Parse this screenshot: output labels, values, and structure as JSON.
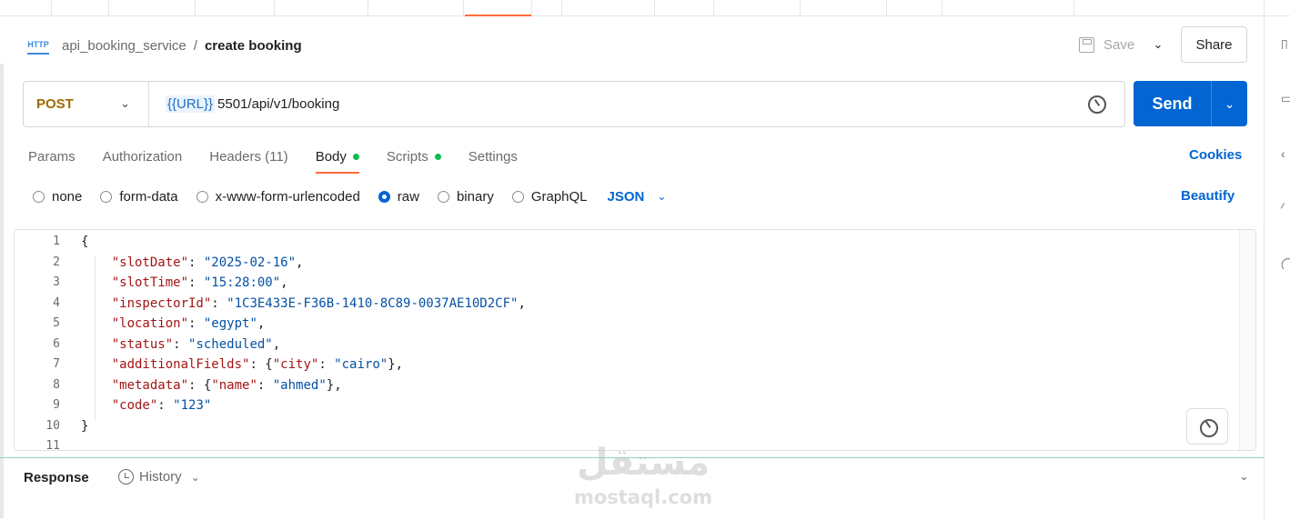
{
  "breadcrumb": {
    "collection": "api_booking_service",
    "separator": "/",
    "request": "create booking"
  },
  "toolbar": {
    "save_label": "Save",
    "share_label": "Share"
  },
  "request": {
    "method": "POST",
    "url_variable": "{{URL}}",
    "url_path": "5501/api/v1/booking",
    "send_label": "Send"
  },
  "tabs": [
    {
      "label": "Params"
    },
    {
      "label": "Authorization"
    },
    {
      "label": "Headers (11)"
    },
    {
      "label": "Body",
      "active": true,
      "dot_color": "#0cbb52"
    },
    {
      "label": "Scripts",
      "dot_color": "#0cbb52"
    },
    {
      "label": "Settings"
    }
  ],
  "cookies_label": "Cookies",
  "body_types": {
    "options": [
      "none",
      "form-data",
      "x-www-form-urlencoded",
      "raw",
      "binary",
      "GraphQL"
    ],
    "selected": "raw",
    "format": "JSON",
    "beautify_label": "Beautify"
  },
  "editor": {
    "line_numbers": [
      "1",
      "2",
      "3",
      "4",
      "5",
      "6",
      "7",
      "8",
      "9",
      "10",
      "11"
    ],
    "lines": [
      "{",
      "    \"slotDate\": \"2025-02-16\",",
      "    \"slotTime\": \"15:28:00\",",
      "    \"inspectorId\": \"1C3E433E-F36B-1410-8C89-0037AE10D2CF\",",
      "    \"location\": \"egypt\",",
      "    \"status\": \"scheduled\",",
      "    \"additionalFields\": {\"city\": \"cairo\"},",
      "    \"metadata\": {\"name\": \"ahmed\"},",
      "    \"code\": \"123\"",
      "}",
      ""
    ]
  },
  "response": {
    "label": "Response",
    "history_label": "History"
  },
  "watermark": {
    "logo_text": "مستقل",
    "site": "mostaql.com"
  },
  "colors": {
    "accent": "#ff6c37",
    "primary_blue": "#0265d2",
    "method_post": "#a06a00",
    "json_key": "#a31515",
    "json_string": "#0451a5"
  },
  "icons": {
    "http": "http-icon",
    "save": "floppy-disk-icon",
    "url_settings": "gear-sparkle-icon",
    "history": "clock-icon"
  }
}
